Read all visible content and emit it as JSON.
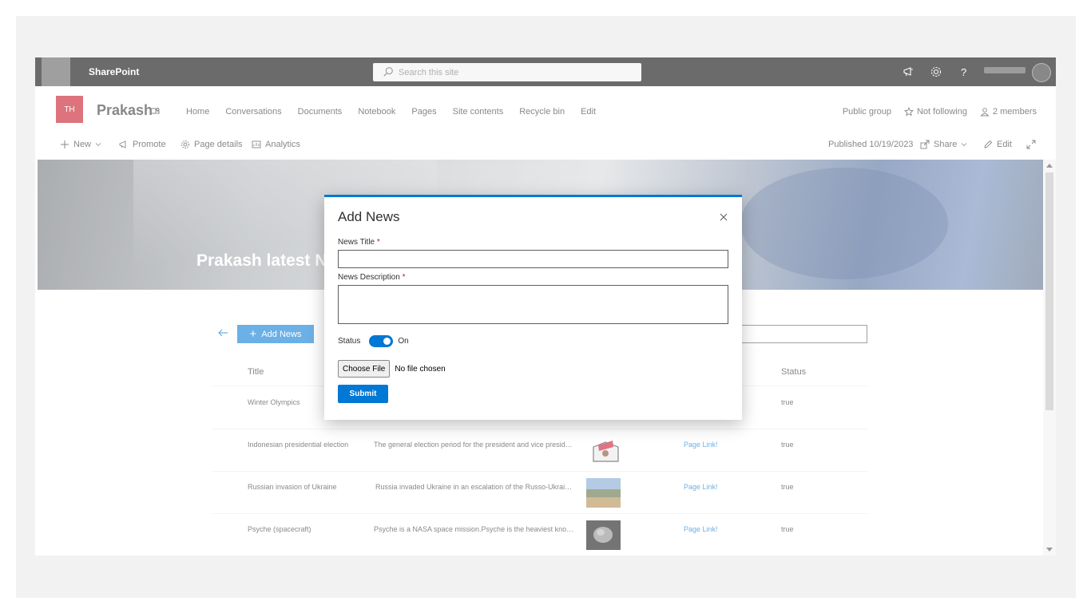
{
  "suite": {
    "brand": "SharePoint",
    "search_placeholder": "Search this site",
    "icons": [
      "megaphone-icon",
      "gear-icon",
      "help-icon"
    ]
  },
  "site": {
    "logo_initials": "TH",
    "title": "Prakash",
    "nav": [
      "Home",
      "Conversations",
      "Documents",
      "Notebook",
      "Pages",
      "Site contents",
      "Recycle bin",
      "Edit"
    ],
    "group_type": "Public group",
    "follow_label": "Not following",
    "members_label": "2 members"
  },
  "command_bar": {
    "new_label": "New",
    "promote_label": "Promote",
    "page_details_label": "Page details",
    "analytics_label": "Analytics",
    "published_label": "Published 10/19/2023",
    "share_label": "Share",
    "edit_label": "Edit"
  },
  "hero": {
    "title": "Prakash latest N"
  },
  "webpart": {
    "add_news_label": "Add News",
    "columns": {
      "title": "Title",
      "status": "Status"
    },
    "rows": [
      {
        "title": "Winter Olympics",
        "description": "",
        "link": "",
        "status": "true"
      },
      {
        "title": "Indonesian presidential election",
        "description": "The general election period for the president and vice president ...",
        "link": "Page Link!",
        "status": "true"
      },
      {
        "title": "Russian invasion of Ukraine",
        "description": "Russia invaded Ukraine in an escalation of the Russo-Ukrainian ...",
        "link": "Page Link!",
        "status": "true"
      },
      {
        "title": "Psyche (spacecraft)",
        "description": "Psyche is a NASA space mission.Psyche is the heaviest known M...",
        "link": "Page Link!",
        "status": "true"
      }
    ]
  },
  "modal": {
    "title": "Add News",
    "news_title_label": "News Title",
    "news_title_value": "",
    "news_description_label": "News Description",
    "news_description_value": "",
    "required_mark": "*",
    "status_label": "Status",
    "status_value": "On",
    "choose_file_label": "Choose File",
    "file_status": "No file chosen",
    "submit_label": "Submit"
  },
  "colors": {
    "accent": "#0078d4",
    "site_logo": "#c50f1f",
    "suitebar": "#000000"
  }
}
